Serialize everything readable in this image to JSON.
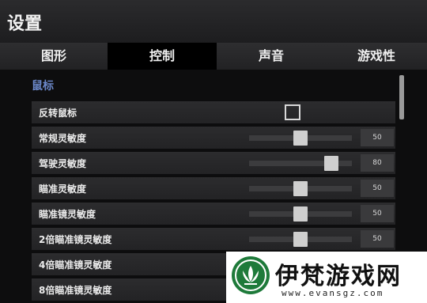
{
  "window": {
    "title": "设置"
  },
  "tabs": [
    {
      "label": "图形",
      "active": false
    },
    {
      "label": "控制",
      "active": true
    },
    {
      "label": "声音",
      "active": false
    },
    {
      "label": "游戏性",
      "active": false
    }
  ],
  "section": {
    "title": "鼠标"
  },
  "rows": [
    {
      "label": "反转鼠标",
      "control": "checkbox",
      "checked": false
    },
    {
      "label": "常规灵敏度",
      "control": "slider",
      "value": "50",
      "level": 0.5
    },
    {
      "label": "驾驶灵敏度",
      "control": "slider",
      "value": "80",
      "level": 0.8
    },
    {
      "label": "瞄准灵敏度",
      "control": "slider",
      "value": "50",
      "level": 0.5
    },
    {
      "label": "瞄准镜灵敏度",
      "control": "slider",
      "value": "50",
      "level": 0.5
    },
    {
      "label": "2倍瞄准镜灵敏度",
      "control": "slider",
      "value": "50",
      "level": 0.5
    },
    {
      "label": "4倍瞄准镜灵敏度",
      "control": "slider",
      "value": "",
      "level": 0.5
    },
    {
      "label": "8倍瞄准镜灵敏度",
      "control": "slider",
      "value": "",
      "level": 0.5
    }
  ],
  "watermark": {
    "name": "伊梵游戏网",
    "url": "www.evansgz.com",
    "logo_icon": "lotus-logo-icon"
  },
  "colors": {
    "accent": "#6b88c9",
    "logo_green": "#1e7a3a"
  }
}
